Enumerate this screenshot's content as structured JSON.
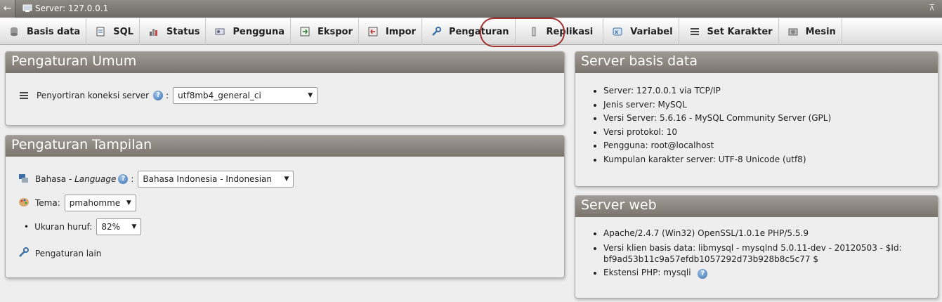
{
  "window": {
    "title": "Server: 127.0.0.1"
  },
  "tabs": [
    {
      "label": "Basis data",
      "icon": "database-icon"
    },
    {
      "label": "SQL",
      "icon": "sql-icon"
    },
    {
      "label": "Status",
      "icon": "status-icon"
    },
    {
      "label": "Pengguna",
      "icon": "users-icon"
    },
    {
      "label": "Ekspor",
      "icon": "export-icon"
    },
    {
      "label": "Impor",
      "icon": "import-icon"
    },
    {
      "label": "Pengaturan",
      "icon": "wrench-icon"
    },
    {
      "label": "Replikasi",
      "icon": "replication-icon"
    },
    {
      "label": "Variabel",
      "icon": "variables-icon"
    },
    {
      "label": "Set Karakter",
      "icon": "charset-icon"
    },
    {
      "label": "Mesin",
      "icon": "engines-icon"
    }
  ],
  "general": {
    "title": "Pengaturan Umum",
    "collation_label": "Penyortiran koneksi server",
    "collation_value": "utf8mb4_general_ci"
  },
  "appearance": {
    "title": "Pengaturan Tampilan",
    "language_label": "Bahasa - ",
    "language_label_italic": "Language",
    "language_value": "Bahasa Indonesia - Indonesian",
    "theme_label": "Tema:",
    "theme_value": "pmahomme",
    "fontsize_label": "Ukuran huruf:",
    "fontsize_value": "82%",
    "more_settings": "Pengaturan lain"
  },
  "db_server": {
    "title": "Server basis data",
    "items": [
      "Server: 127.0.0.1 via TCP/IP",
      "Jenis server: MySQL",
      "Versi Server: 5.6.16 - MySQL Community Server (GPL)",
      "Versi protokol: 10",
      "Pengguna: root@localhost",
      "Kumpulan karakter server: UTF-8 Unicode (utf8)"
    ]
  },
  "web_server": {
    "title": "Server web",
    "items": [
      "Apache/2.4.7 (Win32) OpenSSL/1.0.1e PHP/5.5.9",
      "Versi klien basis data: libmysql - mysqlnd 5.0.11-dev - 20120503 - $Id: bf9ad53b11c9a57efdb1057292d73b928b8c5c77 $",
      "Ekstensi PHP: mysqli"
    ]
  },
  "colors": {
    "highlight_ring": "#a03030",
    "panel_header": "#8a847d"
  }
}
